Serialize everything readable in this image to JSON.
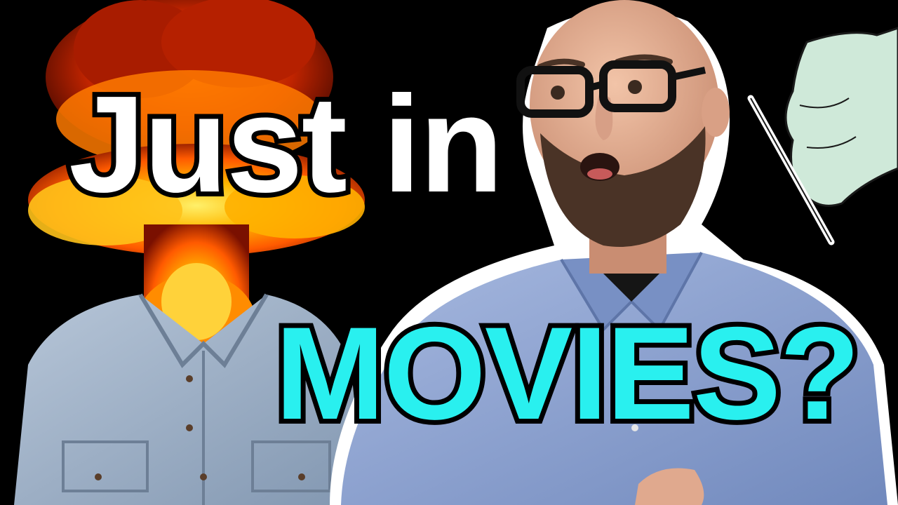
{
  "thumbnail": {
    "headline_top": "Just in",
    "headline_bottom": "MOVIES?"
  },
  "colors": {
    "background": "#000000",
    "headline_top_fill": "#ffffff",
    "headline_bottom_fill": "#29f0ef",
    "outline": "#000000",
    "fire_core": "#ffd21a",
    "fire_mid": "#ff6a00",
    "fire_dark": "#9a1500",
    "shirt_left": "#9fb3cc",
    "shirt_right": "#8ea6d6",
    "hand_drawing": "#cfe9d9"
  }
}
